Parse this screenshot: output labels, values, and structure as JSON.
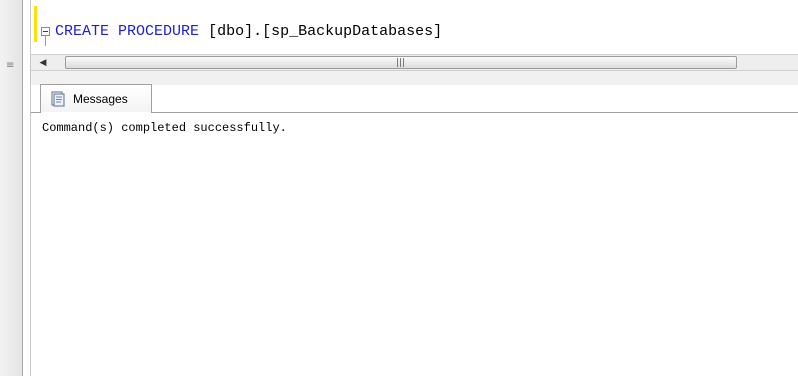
{
  "editor": {
    "code": {
      "keyword1": "CREATE",
      "keyword2": "PROCEDURE",
      "object": "[dbo].[sp_BackupDatabases]"
    }
  },
  "results": {
    "tab_label": "Messages",
    "message": "Command(s) completed successfully."
  },
  "icons": {
    "outline_collapse": "minus-box-icon",
    "scroll_left": "arrow-left-icon",
    "scroll_grip": "grip-icon",
    "messages_tab": "document-icon"
  },
  "colors": {
    "keyword": "#1f1fd6",
    "change_marker": "#f7e400"
  }
}
